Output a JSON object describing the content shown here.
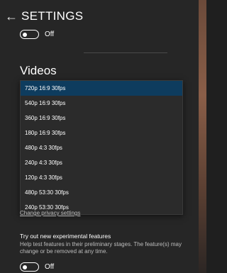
{
  "header": {
    "title": "SETTINGS",
    "back_glyph": "←"
  },
  "top_toggle": {
    "label": "Off",
    "state": "off"
  },
  "videos": {
    "title": "Videos",
    "selected": "720p 16:9 30fps",
    "options": [
      "720p 16:9 30fps",
      "540p 16:9 30fps",
      "360p 16:9 30fps",
      "180p 16:9 30fps",
      "480p 4:3 30fps",
      "240p 4:3 30fps",
      "120p 4:3 30fps",
      "480p 53:30 30fps",
      "240p 53:30 30fps"
    ]
  },
  "privacy": {
    "link_text": "Change privacy settings"
  },
  "experimental": {
    "title": "Try out new experimental features",
    "description": "Help test features in their preliminary stages. The feature(s) may change or be removed at any time.",
    "toggle_label": "Off",
    "state": "off"
  },
  "colors": {
    "background": "#262626",
    "selected_item": "#0e3c5e",
    "text": "#ffffff",
    "secondary_text": "#bdbdbd"
  },
  "icons": {
    "back": "back-arrow-icon"
  }
}
